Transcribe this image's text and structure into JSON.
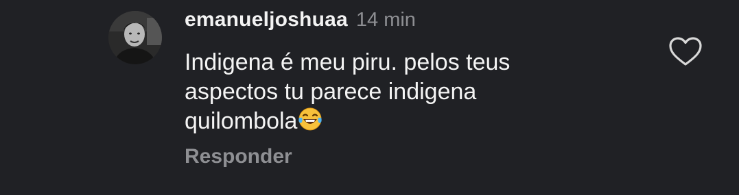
{
  "comment": {
    "username": "emanueljoshuaa",
    "time": "14 min",
    "text_lines": [
      "Indigena é meu piru. pelos teus",
      "aspectos tu parece indigena",
      "quilombola"
    ],
    "emoji": "face-with-tears-of-joy",
    "reply_label": "Responder",
    "like_icon": "heart-outline-icon"
  },
  "colors": {
    "background": "#202125",
    "primary_text": "#f4f4f4",
    "secondary_text": "#8e8f93",
    "icon": "#d8d8d8"
  }
}
